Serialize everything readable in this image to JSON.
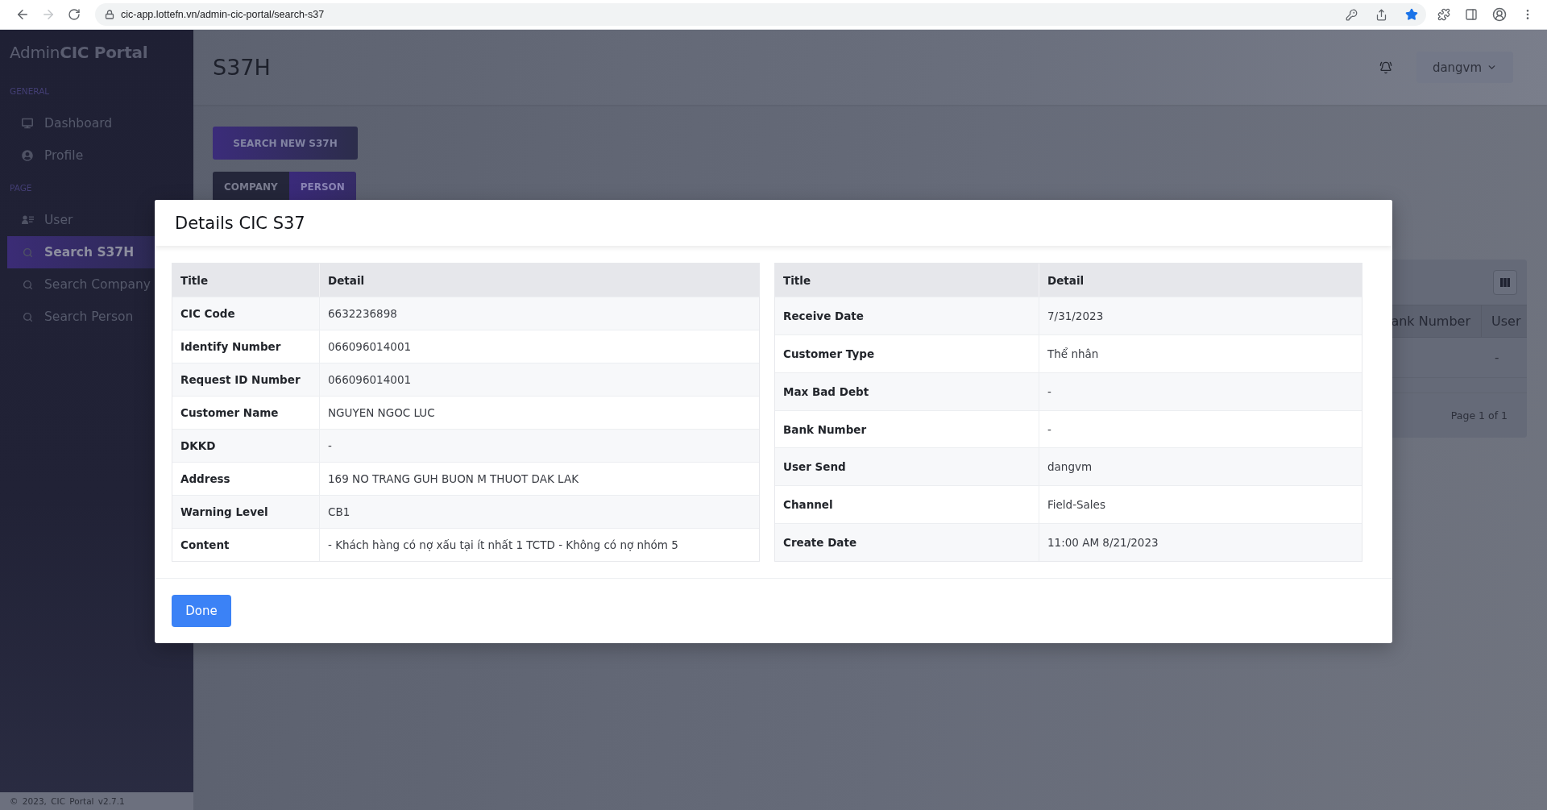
{
  "browser": {
    "url": "cic-app.lottefn.vn/admin-cic-portal/search-s37",
    "forward_disabled": true,
    "bookmarked": true
  },
  "sidebar": {
    "brand": "Admin**CIC Portal**",
    "sections": [
      {
        "heading": "GENERAL",
        "items": [
          {
            "label": "Dashboard",
            "kind": "dashboard",
            "selected": false
          },
          {
            "label": "Profile",
            "kind": "profile",
            "selected": false
          }
        ]
      },
      {
        "heading": "PAGE",
        "items": [
          {
            "label": "User",
            "kind": "user",
            "selected": false
          },
          {
            "label": "Search S37H",
            "kind": "search",
            "selected": true
          },
          {
            "label": "Search Company",
            "kind": "search",
            "selected": false
          },
          {
            "label": "Search Person",
            "kind": "search",
            "selected": false
          }
        ]
      }
    ],
    "footer": "© 2023, CIC Portal v2.7.1"
  },
  "header": {
    "title": "S37H",
    "user_menu": "dangvm"
  },
  "toolbar": {
    "search_button": "SEARCH NEW S37H",
    "tabs": [
      {
        "label": "COMPANY",
        "selected": false
      },
      {
        "label": "PERSON",
        "selected": true
      }
    ]
  },
  "results_card": {
    "columns": [
      {
        "label": "ank Number"
      },
      {
        "label": "User"
      }
    ],
    "rows": [
      {
        "column_2": "-"
      }
    ],
    "pagination": "Page 1 of 1"
  },
  "modal": {
    "title": "Details CIC S37",
    "tables": [
      {
        "columns": [
          "Title",
          "Detail"
        ],
        "rows": [
          {
            "title": "CIC Code",
            "detail": "6632236898"
          },
          {
            "title": "Identify Number",
            "detail": "066096014001"
          },
          {
            "title": "Request ID Number",
            "detail": "066096014001"
          },
          {
            "title": "Customer Name",
            "detail": "NGUYEN NGOC LUC"
          },
          {
            "title": "DKKD",
            "detail": "-"
          },
          {
            "title": "Address",
            "detail": "169 NO TRANG GUH BUON M THUOT DAK LAK"
          },
          {
            "title": "Warning Level",
            "detail": "CB1"
          },
          {
            "title": "Content",
            "detail": "- Khách hàng có nợ xấu tại ít nhất 1 TCTD - Không có nợ nhóm 5"
          }
        ]
      },
      {
        "columns": [
          "Title",
          "Detail"
        ],
        "rows": [
          {
            "title": "Receive Date",
            "detail": "7/31/2023"
          },
          {
            "title": "Customer Type",
            "detail": "Thể nhân"
          },
          {
            "title": "Max Bad Debt",
            "detail": "-"
          },
          {
            "title": "Bank Number",
            "detail": "-"
          },
          {
            "title": "User Send",
            "detail": "dangvm"
          },
          {
            "title": "Channel",
            "detail": "Field-Sales"
          },
          {
            "title": "Create Date",
            "detail": "11:00 AM 8/21/2023"
          }
        ]
      }
    ],
    "done_button": "Done"
  }
}
